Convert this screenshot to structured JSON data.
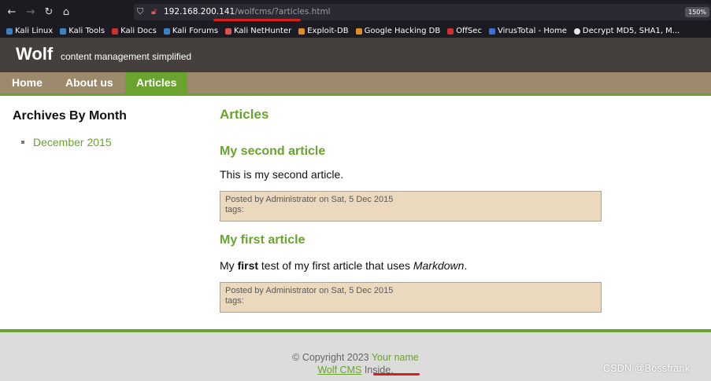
{
  "browser": {
    "url_host": "192.168.200.141",
    "url_path": "/wolfcms/?articles.html",
    "zoom": "150%",
    "bookmarks": [
      {
        "label": "Kali Linux",
        "icon": "kali-icon",
        "color": "#3b82c4"
      },
      {
        "label": "Kali Tools",
        "icon": "kali-tools-icon",
        "color": "#3b82c4"
      },
      {
        "label": "Kali Docs",
        "icon": "kali-docs-icon",
        "color": "#d03030"
      },
      {
        "label": "Kali Forums",
        "icon": "kali-forums-icon",
        "color": "#3b82c4"
      },
      {
        "label": "Kali NetHunter",
        "icon": "nethunter-icon",
        "color": "#e05050"
      },
      {
        "label": "Exploit-DB",
        "icon": "exploit-db-icon",
        "color": "#e08a2a"
      },
      {
        "label": "Google Hacking DB",
        "icon": "ghdb-icon",
        "color": "#e08a2a"
      },
      {
        "label": "OffSec",
        "icon": "offsec-icon",
        "color": "#d03030"
      },
      {
        "label": "VirusTotal - Home",
        "icon": "virustotal-icon",
        "color": "#3b6fd8"
      },
      {
        "label": "Decrypt MD5, SHA1, M...",
        "icon": "decrypt-icon",
        "color": "#e8e8e8"
      }
    ]
  },
  "site": {
    "name": "Wolf",
    "slogan": "content management simplified"
  },
  "nav": [
    {
      "label": "Home",
      "active": false
    },
    {
      "label": "About us",
      "active": false
    },
    {
      "label": "Articles",
      "active": true
    }
  ],
  "sidebar": {
    "title": "Archives By Month",
    "items": [
      {
        "label": "December 2015"
      }
    ]
  },
  "main": {
    "title": "Articles",
    "articles": [
      {
        "title": "My second article",
        "body": "This is my second article.",
        "meta": "Posted by Administrator on Sat, 5 Dec 2015",
        "tags": "tags:"
      },
      {
        "title": "My first article",
        "body_prefix": "My ",
        "body_bold": "first",
        "body_middle": " test of my first article that uses ",
        "body_italic": "Markdown",
        "body_suffix": ".",
        "meta": "Posted by Administrator on Sat, 5 Dec 2015",
        "tags": "tags:"
      }
    ]
  },
  "footer": {
    "copyright": "© Copyright 2023",
    "author_link": "Your name",
    "cms_link": "Wolf CMS",
    "inside": "Inside."
  },
  "watermark": "CSDN @Bossfrank",
  "colors": {
    "accent": "#6aa32e",
    "header_bg": "#45403b",
    "nav_bg": "#9d8a6d",
    "meta_bg": "#ead9bd",
    "annotation_red": "#d62020"
  }
}
